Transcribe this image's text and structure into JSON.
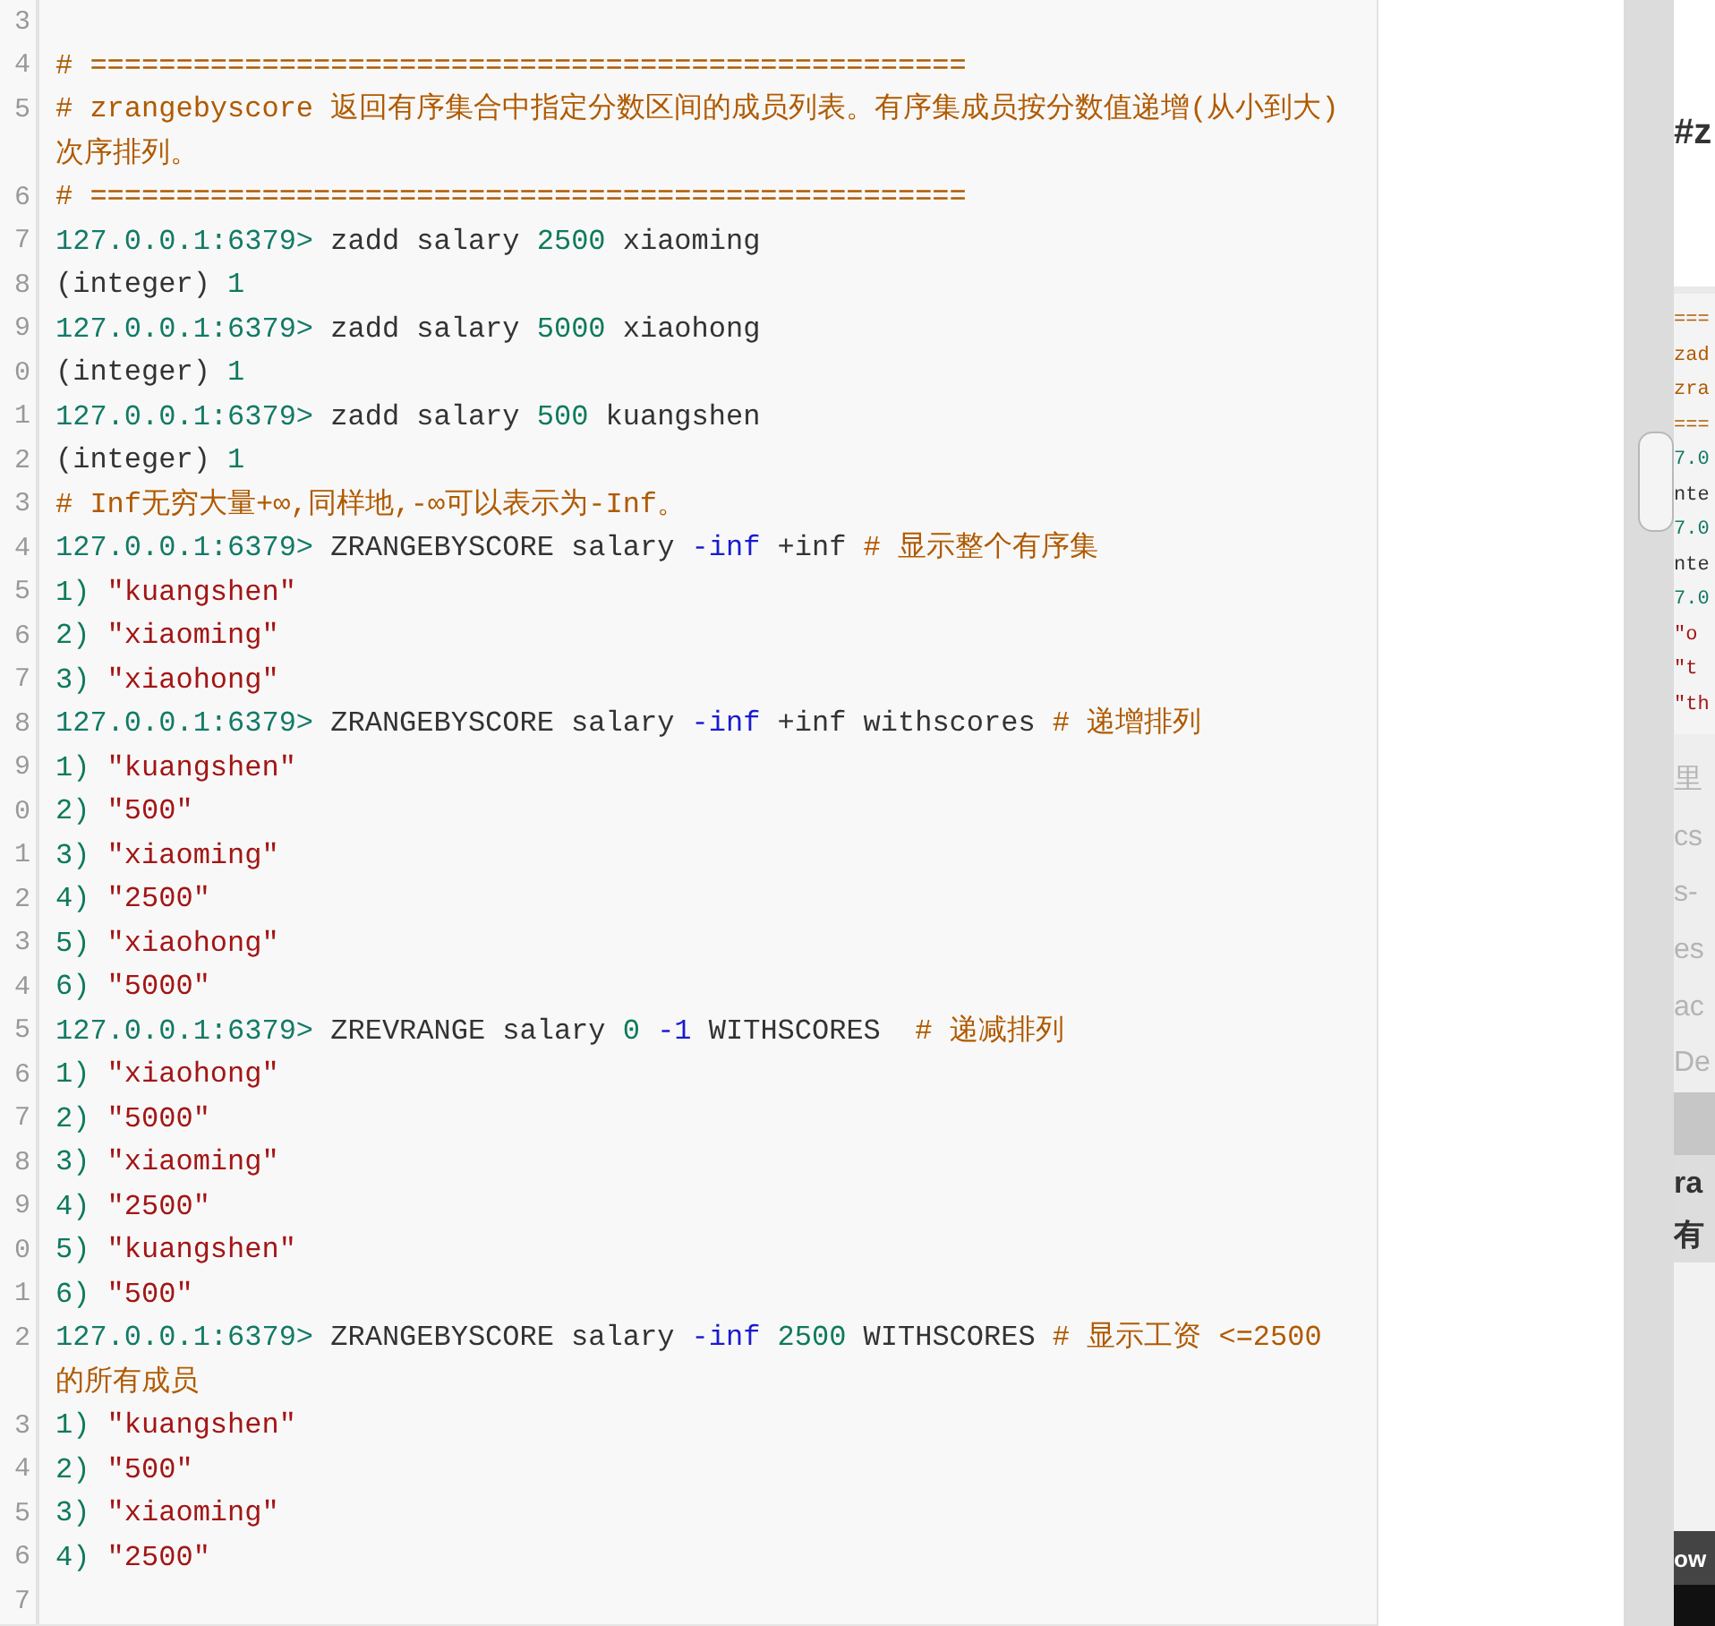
{
  "editor": {
    "lines": [
      {
        "number": "3"
      },
      {
        "number": "4",
        "tokens": [
          {
            "kind": "comment",
            "text": "# ==================================================="
          }
        ]
      },
      {
        "number": "5",
        "tokens": [
          {
            "kind": "comment",
            "text": "# zrangebyscore 返回有序集合中指定分数区间的成员列表。有序集成员按分数值递增(从小到大)"
          }
        ]
      },
      {
        "tokens": [
          {
            "kind": "comment",
            "text": "次序排列。"
          }
        ]
      },
      {
        "number": "6",
        "tokens": [
          {
            "kind": "comment",
            "text": "# ==================================================="
          }
        ]
      },
      {
        "number": "7",
        "tokens": [
          {
            "kind": "prompt",
            "text": "127.0.0.1:6379>"
          },
          {
            "kind": "plain",
            "text": " zadd salary "
          },
          {
            "kind": "number",
            "text": "2500"
          },
          {
            "kind": "plain",
            "text": " xiaoming"
          }
        ]
      },
      {
        "number": "8",
        "tokens": [
          {
            "kind": "plain",
            "text": "(integer) "
          },
          {
            "kind": "number",
            "text": "1"
          }
        ]
      },
      {
        "number": "9",
        "tokens": [
          {
            "kind": "prompt",
            "text": "127.0.0.1:6379>"
          },
          {
            "kind": "plain",
            "text": " zadd salary "
          },
          {
            "kind": "number",
            "text": "5000"
          },
          {
            "kind": "plain",
            "text": " xiaohong"
          }
        ]
      },
      {
        "number": "0",
        "tokens": [
          {
            "kind": "plain",
            "text": "(integer) "
          },
          {
            "kind": "number",
            "text": "1"
          }
        ]
      },
      {
        "number": "1",
        "tokens": [
          {
            "kind": "prompt",
            "text": "127.0.0.1:6379>"
          },
          {
            "kind": "plain",
            "text": " zadd salary "
          },
          {
            "kind": "number",
            "text": "500"
          },
          {
            "kind": "plain",
            "text": " kuangshen"
          }
        ]
      },
      {
        "number": "2",
        "tokens": [
          {
            "kind": "plain",
            "text": "(integer) "
          },
          {
            "kind": "number",
            "text": "1"
          }
        ]
      },
      {
        "number": "3",
        "tokens": [
          {
            "kind": "comment",
            "text": "# Inf无穷大量+∞,同样地,-∞可以表示为-Inf。"
          }
        ]
      },
      {
        "number": "4",
        "tokens": [
          {
            "kind": "prompt",
            "text": "127.0.0.1:6379>"
          },
          {
            "kind": "plain",
            "text": " ZRANGEBYSCORE salary "
          },
          {
            "kind": "keyword",
            "text": "-inf"
          },
          {
            "kind": "plain",
            "text": " +inf "
          },
          {
            "kind": "comment",
            "text": "# 显示整个有序集"
          }
        ]
      },
      {
        "number": "5",
        "tokens": [
          {
            "kind": "number",
            "text": "1)"
          },
          {
            "kind": "string",
            "text": " \"kuangshen\""
          }
        ]
      },
      {
        "number": "6",
        "tokens": [
          {
            "kind": "number",
            "text": "2)"
          },
          {
            "kind": "string",
            "text": " \"xiaoming\""
          }
        ]
      },
      {
        "number": "7",
        "tokens": [
          {
            "kind": "number",
            "text": "3)"
          },
          {
            "kind": "string",
            "text": " \"xiaohong\""
          }
        ]
      },
      {
        "number": "8",
        "tokens": [
          {
            "kind": "prompt",
            "text": "127.0.0.1:6379>"
          },
          {
            "kind": "plain",
            "text": " ZRANGEBYSCORE salary "
          },
          {
            "kind": "keyword",
            "text": "-inf"
          },
          {
            "kind": "plain",
            "text": " +inf withscores "
          },
          {
            "kind": "comment",
            "text": "# 递增排列"
          }
        ]
      },
      {
        "number": "9",
        "tokens": [
          {
            "kind": "number",
            "text": "1)"
          },
          {
            "kind": "string",
            "text": " \"kuangshen\""
          }
        ]
      },
      {
        "number": "0",
        "tokens": [
          {
            "kind": "number",
            "text": "2)"
          },
          {
            "kind": "string",
            "text": " \"500\""
          }
        ]
      },
      {
        "number": "1",
        "tokens": [
          {
            "kind": "number",
            "text": "3)"
          },
          {
            "kind": "string",
            "text": " \"xiaoming\""
          }
        ]
      },
      {
        "number": "2",
        "tokens": [
          {
            "kind": "number",
            "text": "4)"
          },
          {
            "kind": "string",
            "text": " \"2500\""
          }
        ]
      },
      {
        "number": "3",
        "tokens": [
          {
            "kind": "number",
            "text": "5)"
          },
          {
            "kind": "string",
            "text": " \"xiaohong\""
          }
        ]
      },
      {
        "number": "4",
        "tokens": [
          {
            "kind": "number",
            "text": "6)"
          },
          {
            "kind": "string",
            "text": " \"5000\""
          }
        ]
      },
      {
        "number": "5",
        "tokens": [
          {
            "kind": "prompt",
            "text": "127.0.0.1:6379>"
          },
          {
            "kind": "plain",
            "text": " ZREVRANGE salary "
          },
          {
            "kind": "number",
            "text": "0"
          },
          {
            "kind": "keyword",
            "text": " -1"
          },
          {
            "kind": "plain",
            "text": " WITHSCORES  "
          },
          {
            "kind": "comment",
            "text": "# 递减排列"
          }
        ]
      },
      {
        "number": "6",
        "tokens": [
          {
            "kind": "number",
            "text": "1)"
          },
          {
            "kind": "string",
            "text": " \"xiaohong\""
          }
        ]
      },
      {
        "number": "7",
        "tokens": [
          {
            "kind": "number",
            "text": "2)"
          },
          {
            "kind": "string",
            "text": " \"5000\""
          }
        ]
      },
      {
        "number": "8",
        "tokens": [
          {
            "kind": "number",
            "text": "3)"
          },
          {
            "kind": "string",
            "text": " \"xiaoming\""
          }
        ]
      },
      {
        "number": "9",
        "tokens": [
          {
            "kind": "number",
            "text": "4)"
          },
          {
            "kind": "string",
            "text": " \"2500\""
          }
        ]
      },
      {
        "number": "0",
        "tokens": [
          {
            "kind": "number",
            "text": "5)"
          },
          {
            "kind": "string",
            "text": " \"kuangshen\""
          }
        ]
      },
      {
        "number": "1",
        "tokens": [
          {
            "kind": "number",
            "text": "6)"
          },
          {
            "kind": "string",
            "text": " \"500\""
          }
        ]
      },
      {
        "number": "2",
        "tokens": [
          {
            "kind": "prompt",
            "text": "127.0.0.1:6379>"
          },
          {
            "kind": "plain",
            "text": " ZRANGEBYSCORE salary "
          },
          {
            "kind": "keyword",
            "text": "-inf"
          },
          {
            "kind": "number",
            "text": " 2500"
          },
          {
            "kind": "plain",
            "text": " WITHSCORES "
          },
          {
            "kind": "comment",
            "text": "# 显示工资 <=2500"
          }
        ]
      },
      {
        "tokens": [
          {
            "kind": "comment",
            "text": "的所有成员"
          }
        ]
      },
      {
        "number": "3",
        "tokens": [
          {
            "kind": "number",
            "text": "1)"
          },
          {
            "kind": "string",
            "text": " \"kuangshen\""
          }
        ]
      },
      {
        "number": "4",
        "tokens": [
          {
            "kind": "number",
            "text": "2)"
          },
          {
            "kind": "string",
            "text": " \"500\""
          }
        ]
      },
      {
        "number": "5",
        "tokens": [
          {
            "kind": "number",
            "text": "3)"
          },
          {
            "kind": "string",
            "text": " \"xiaoming\""
          }
        ]
      },
      {
        "number": "6",
        "tokens": [
          {
            "kind": "number",
            "text": "4)"
          },
          {
            "kind": "string",
            "text": " \"2500\""
          }
        ]
      },
      {
        "number": "7"
      }
    ]
  },
  "background_window": {
    "heading": "#z",
    "code_lines": [
      {
        "kind": "comment",
        "text": "==="
      },
      {
        "kind": "comment",
        "text": "zad"
      },
      {
        "kind": "comment",
        "text": "zra"
      },
      {
        "kind": "comment",
        "text": "==="
      },
      {
        "kind": "prompt",
        "text": "7.0"
      },
      {
        "kind": "plain",
        "text": "nte"
      },
      {
        "kind": "prompt",
        "text": "7.0"
      },
      {
        "kind": "plain",
        "text": "nte"
      },
      {
        "kind": "prompt",
        "text": "7.0"
      },
      {
        "kind": "string",
        "text": "\"o"
      },
      {
        "kind": "string",
        "text": "\"t"
      },
      {
        "kind": "string",
        "text": "\"th"
      }
    ],
    "faded_lines": [
      "里",
      "cs",
      "s-",
      "es",
      "ac",
      "De"
    ],
    "bold_lines": [
      "ra",
      "有"
    ],
    "footer": "ow"
  }
}
